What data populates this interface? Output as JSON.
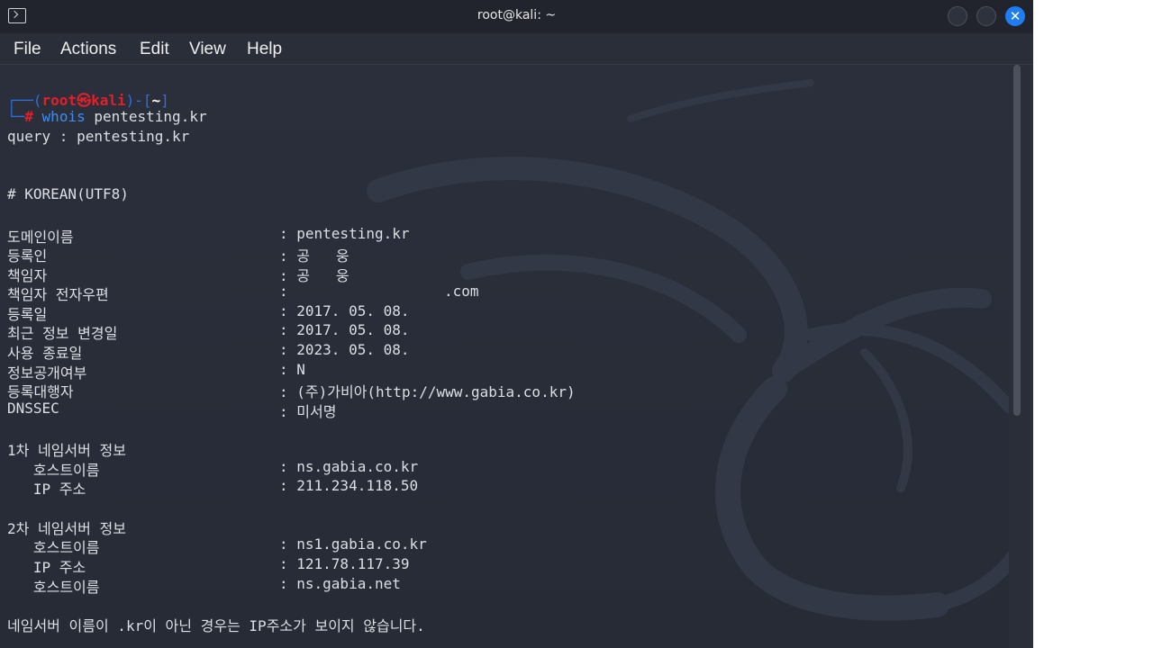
{
  "window": {
    "title": "root@kali: ~"
  },
  "menu": [
    "File",
    "Actions",
    "Edit",
    "View",
    "Help"
  ],
  "prompt": {
    "open": "┌──(",
    "user": "root",
    "at": "㉿",
    "host": "kali",
    "mid": ")-[",
    "dir": "~",
    "close": "]",
    "hash_prefix": "└─",
    "hash": "#",
    "command": "whois",
    "arg": "pentesting.kr"
  },
  "output": {
    "query": "query : pentesting.kr",
    "section_header": "# KOREAN(UTF8)",
    "fields": [
      {
        "label": "도메인이름",
        "value": ": pentesting.kr"
      },
      {
        "label": "등록인",
        "value": ": 공   웅"
      },
      {
        "label": "책임자",
        "value": ": 공   웅"
      },
      {
        "label": "책임자 전자우편",
        "value": ":                  .com"
      },
      {
        "label": "등록일",
        "value": ": 2017. 05. 08."
      },
      {
        "label": "최근 정보 변경일",
        "value": ": 2017. 05. 08."
      },
      {
        "label": "사용 종료일",
        "value": ": 2023. 05. 08."
      },
      {
        "label": "정보공개여부",
        "value": ": N"
      },
      {
        "label": "등록대행자",
        "value": ": (주)가비아(http://www.gabia.co.kr)"
      },
      {
        "label": "DNSSEC",
        "value": ": 미서명"
      }
    ],
    "ns1": {
      "header": "1차 네임서버 정보",
      "rows": [
        {
          "label": "   호스트이름",
          "value": ": ns.gabia.co.kr"
        },
        {
          "label": "   IP 주소",
          "value": ": 211.234.118.50"
        }
      ]
    },
    "ns2": {
      "header": "2차 네임서버 정보",
      "rows": [
        {
          "label": "   호스트이름",
          "value": ": ns1.gabia.co.kr"
        },
        {
          "label": "   IP 주소",
          "value": ": 121.78.117.39"
        },
        {
          "label": "   호스트이름",
          "value": ": ns.gabia.net"
        }
      ]
    },
    "footer": "네임서버 이름이 .kr이 아닌 경우는 IP주소가 보이지 않습니다."
  }
}
